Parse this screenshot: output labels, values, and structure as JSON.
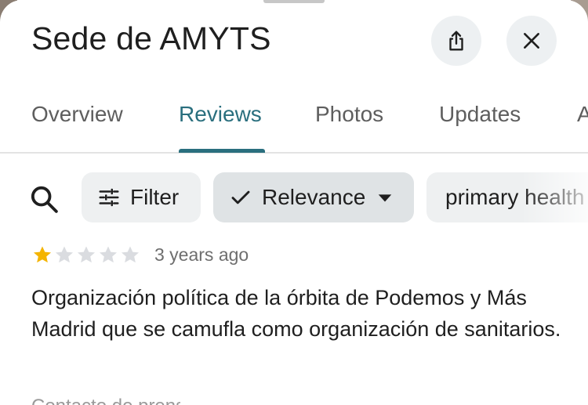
{
  "place": {
    "title": "Sede de AMYTS"
  },
  "header": {
    "share_icon": "share-icon",
    "close_icon": "close-icon"
  },
  "tabs": [
    {
      "label": "Overview",
      "active": false
    },
    {
      "label": "Reviews",
      "active": true
    },
    {
      "label": "Photos",
      "active": false
    },
    {
      "label": "Updates",
      "active": false
    },
    {
      "label": "A",
      "active": false
    }
  ],
  "toolbar": {
    "search_icon": "search-icon",
    "filter_label": "Filter",
    "relevance_label": "Relevance",
    "topic_chip_label": "primary health"
  },
  "review": {
    "rating": 1,
    "max_rating": 5,
    "time_ago": "3 years ago",
    "text": "Organización política de la órbita de Podemos y Más Madrid que se camufla como organización de sanitarios."
  },
  "colors": {
    "accent": "#2a6f7e",
    "star_filled": "#f4b400",
    "star_empty": "#dadce0"
  }
}
